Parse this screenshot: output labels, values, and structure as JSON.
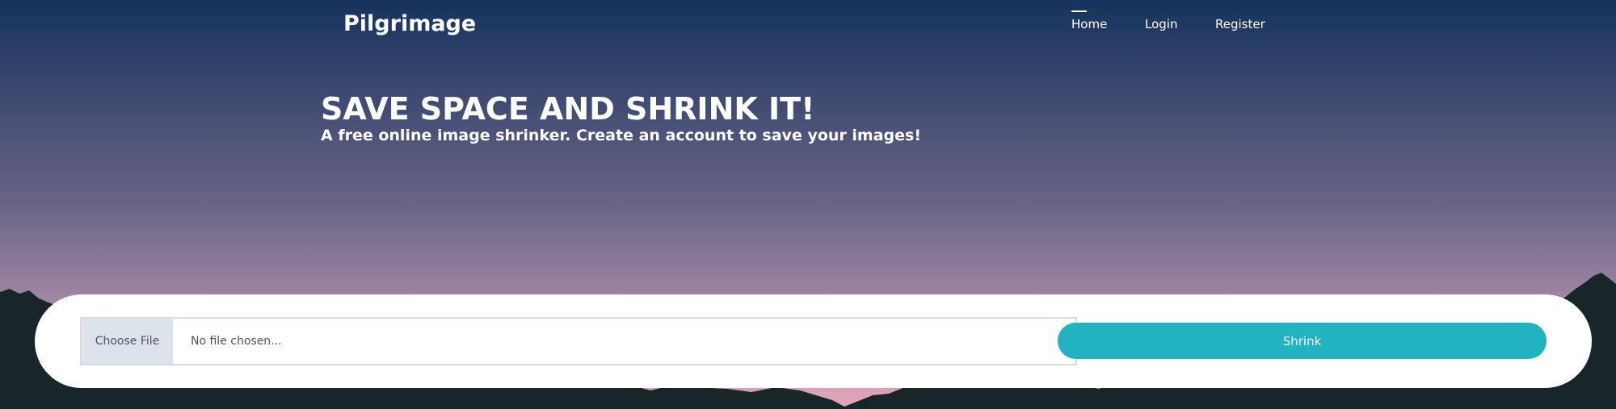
{
  "brand": "Pilgrimage",
  "nav": {
    "items": [
      {
        "label": "Home",
        "active": true
      },
      {
        "label": "Login",
        "active": false
      },
      {
        "label": "Register",
        "active": false
      }
    ]
  },
  "hero": {
    "title": "SAVE SPACE AND SHRINK IT!",
    "subtitle": "A free online image shrinker. Create an account to save your images!"
  },
  "upload": {
    "choose_file_label": "Choose File",
    "file_status": "No file chosen...",
    "submit_label": "Shrink"
  },
  "colors": {
    "button_accent": "#22b3c1",
    "mountain": "#18262a",
    "sky_top": "#15335c",
    "sky_bottom": "#e6a6bb"
  }
}
